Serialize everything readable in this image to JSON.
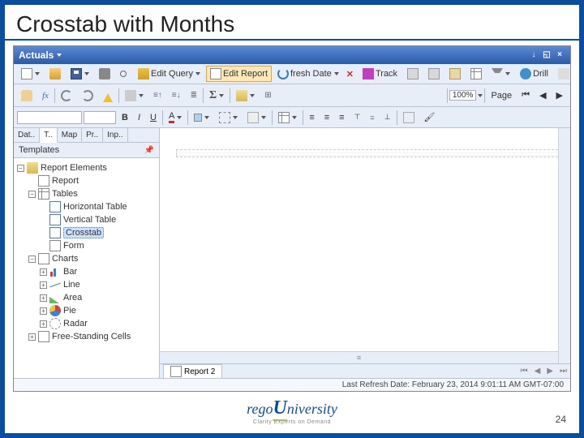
{
  "slide": {
    "title": "Crosstab with Months",
    "page_number": "24"
  },
  "titlebar": {
    "title": "Actuals"
  },
  "toolbar1": {
    "edit_query": "Edit Query",
    "edit_report": "Edit Report",
    "fresh_date": "fresh Date",
    "track": "Track",
    "drill": "Drill"
  },
  "toolbar2": {
    "zoom": "100%",
    "page_label": "Page"
  },
  "format": {
    "bold": "B",
    "italic": "I",
    "underline": "U",
    "font_btn": "A"
  },
  "sidebar": {
    "tabs": [
      "Dat..",
      "T..",
      "Map",
      "Pr..",
      "Inp.."
    ],
    "header": "Templates",
    "tree": {
      "root": "Report Elements",
      "report": "Report",
      "tables": "Tables",
      "htable": "Horizontal Table",
      "vtable": "Vertical Table",
      "crosstab": "Crosstab",
      "form": "Form",
      "charts": "Charts",
      "bar": "Bar",
      "line": "Line",
      "area": "Area",
      "pie": "Pie",
      "radar": "Radar",
      "freestanding": "Free-Standing Cells"
    }
  },
  "report_tab": "Report 2",
  "statusbar": "Last Refresh Date: February 23, 2014 9:01:11 AM GMT-07:00",
  "logo": {
    "brand1": "rego",
    "brand2": "niversity",
    "tagline": "Clarity Experts on Demand"
  }
}
